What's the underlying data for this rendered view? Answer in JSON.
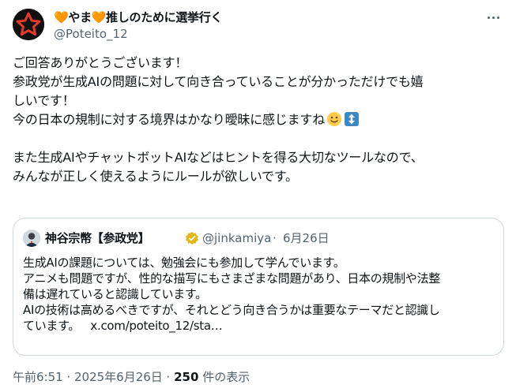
{
  "author": {
    "display_name": "🧡やま🧡推しのために選挙行く",
    "handle": "@Poteito_12"
  },
  "tweet": {
    "lines": [
      "ご回答ありがとうございます！",
      "参政党が生成AIの問題に対して向き合っていることが分かっただけでも嬉",
      "しいです！",
      "今の日本の規制に対する境界はかなり曖昧に感じますね",
      "",
      "また生成AIやチャットボットAIなどはヒントを得る大切なツールなので、",
      "みんなが正しく使えるようにルールが欲しいです。"
    ],
    "emojis": [
      "slightly-smiling-face-icon",
      "up-down-arrow-icon"
    ]
  },
  "quote": {
    "name": "神谷宗幣【参政党】",
    "handle": "@jinkamiya",
    "separator": "·",
    "date": "6月26日",
    "lines": [
      "生成AIの課題については、勉強会にも参加して学んでいます。",
      "アニメも問題ですが、性的な描写にもさまざまな問題があり、日本の規制や法整",
      "備は遅れていると認識しています。",
      "AIの技術は高めるべきですが、それとどう向き合うかは重要なテーマだと認識し"
    ],
    "last_line_prefix": "ています。",
    "link": "x.com/poteito_12/sta…"
  },
  "meta": {
    "time_date": "午前6:51 · 2025年6月26日 · ",
    "views_count": "250",
    "views_label": " 件の表示"
  },
  "colors": {
    "text": "#0f1419",
    "secondary": "#536471",
    "border": "#cfd9de",
    "badge": "#e2b719"
  }
}
